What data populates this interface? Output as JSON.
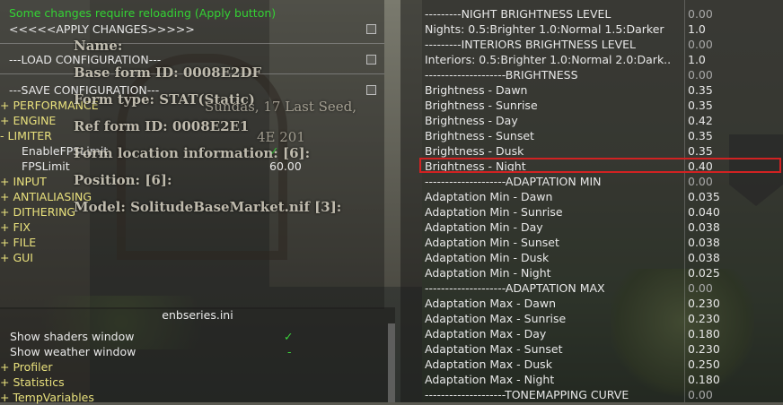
{
  "status": {
    "reload_notice": "Some changes require reloading (Apply button)"
  },
  "left_menu": {
    "apply": "<<<<<APPLY CHANGES>>>>>",
    "load": "---LOAD CONFIGURATION---",
    "save": "---SAVE CONFIGURATION---",
    "performance": "+ PERFORMANCE",
    "engine": "+ ENGINE",
    "limiter": "- LIMITER",
    "enable_fps_limit": "EnableFPSLimit",
    "fps_limit": "FPSLimit",
    "fps_limit_value": "60.00",
    "input": "+ INPUT",
    "antialiasing": "+ ANTIALIASING",
    "dithering": "+ DITHERING",
    "fix": "+ FIX",
    "file": "+ FILE",
    "gui": "+ GUI"
  },
  "console_overlay": {
    "name": "Name:",
    "base_form": "Base form ID: 0008E2DF",
    "form_type": "Form type: STAT(Static)",
    "ref_form": "Ref form ID: 0008E2E1",
    "location": "Form location information: [6]:",
    "position": "Position: [6]:",
    "model": "Model: SolitudeBaseMarket.nif [3]:",
    "date_text": "Sundas, 17 Last Seed,",
    "era_text": "4E 201"
  },
  "enbseries": {
    "title": "enbseries.ini",
    "show_shaders": "Show shaders window",
    "show_weather": "Show weather window",
    "show_weather_value": "-",
    "profiler": "+ Profiler",
    "statistics": "+ Statistics",
    "temp_variables": "+ TempVariables"
  },
  "params": [
    {
      "label": "---------NIGHT BRIGHTNESS LEVEL",
      "value": "0.00",
      "header": true
    },
    {
      "label": "Nights: 0.5:Brighter 1.0:Normal 1.5:Darker",
      "value": "1.0"
    },
    {
      "label": "---------INTERIORS BRIGHTNESS LEVEL",
      "value": "0.00",
      "header": true
    },
    {
      "label": "Interiors: 0.5:Brighter 1.0:Normal 2.0:Dark..",
      "value": "1.0"
    },
    {
      "label": "--------------------BRIGHTNESS",
      "value": "0.00",
      "header": true
    },
    {
      "label": "Brightness - Dawn",
      "value": "0.35"
    },
    {
      "label": "Brightness - Sunrise",
      "value": "0.35"
    },
    {
      "label": "Brightness - Day",
      "value": "0.42"
    },
    {
      "label": "Brightness - Sunset",
      "value": "0.35"
    },
    {
      "label": "Brightness - Dusk",
      "value": "0.35"
    },
    {
      "label": "Brightness - Night",
      "value": "0.40"
    },
    {
      "label": "--------------------ADAPTATION MIN",
      "value": "0.00",
      "header": true
    },
    {
      "label": "Adaptation Min - Dawn",
      "value": "0.035"
    },
    {
      "label": "Adaptation Min - Sunrise",
      "value": "0.040"
    },
    {
      "label": "Adaptation Min - Day",
      "value": "0.038"
    },
    {
      "label": "Adaptation Min - Sunset",
      "value": "0.038"
    },
    {
      "label": "Adaptation Min - Dusk",
      "value": "0.038"
    },
    {
      "label": "Adaptation Min - Night",
      "value": "0.025"
    },
    {
      "label": "--------------------ADAPTATION MAX",
      "value": "0.00",
      "header": true
    },
    {
      "label": "Adaptation Max - Dawn",
      "value": "0.230"
    },
    {
      "label": "Adaptation Max - Sunrise",
      "value": "0.230"
    },
    {
      "label": "Adaptation Max - Day",
      "value": "0.180"
    },
    {
      "label": "Adaptation Max - Sunset",
      "value": "0.230"
    },
    {
      "label": "Adaptation Max - Dusk",
      "value": "0.250"
    },
    {
      "label": "Adaptation Max - Night",
      "value": "0.180"
    },
    {
      "label": "--------------------TONEMAPPING CURVE",
      "value": "0.00",
      "header": true
    }
  ],
  "colors": {
    "highlight": "#d12222",
    "check": "#3bd83b",
    "notice": "#34d234",
    "category": "#e8e07c"
  }
}
